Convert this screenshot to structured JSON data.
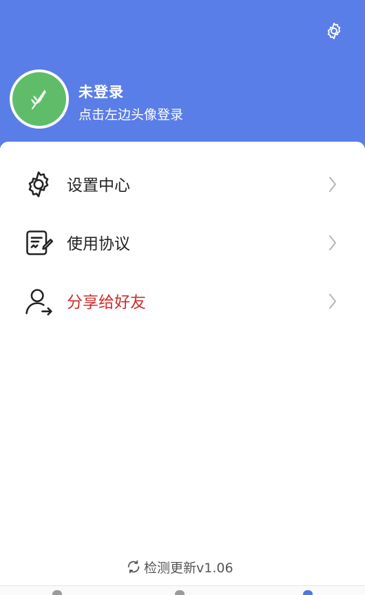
{
  "header": {
    "settings_icon": "gear-icon",
    "bg_color": "#5a7ee8",
    "user": {
      "avatar_icon": "wheat-icon",
      "title": "未登录",
      "subtitle": "点击左边头像登录"
    }
  },
  "menu": [
    {
      "icon": "gear-icon",
      "label": "设置中心",
      "color": "#222222"
    },
    {
      "icon": "document-edit-icon",
      "label": "使用协议",
      "color": "#222222"
    },
    {
      "icon": "user-share-icon",
      "label": "分享给好友",
      "color": "#cf2b2b"
    }
  ],
  "footer": {
    "update_icon": "refresh-icon",
    "update_label": "检测更新v1.06"
  }
}
